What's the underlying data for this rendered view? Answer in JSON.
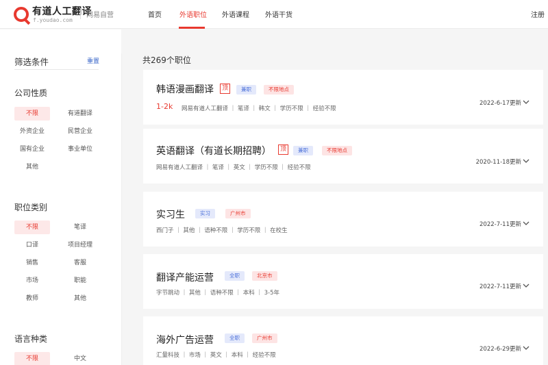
{
  "header": {
    "brand_title": "有道人工翻译",
    "brand_sub": "f.youdao.com",
    "brand_tag": "网易自营",
    "nav": [
      "首页",
      "外语职位",
      "外语课程",
      "外语干货"
    ],
    "register": "注册"
  },
  "sidebar": {
    "title": "筛选条件",
    "reset": "重置",
    "groups": [
      {
        "title": "公司性质",
        "options": [
          "不限",
          "有道翻译",
          "外资企业",
          "民营企业",
          "国有企业",
          "事业单位",
          "其他"
        ]
      },
      {
        "title": "职位类别",
        "options": [
          "不限",
          "笔译",
          "口译",
          "项目经理",
          "销售",
          "客服",
          "市场",
          "职能",
          "教师",
          "其他"
        ]
      },
      {
        "title": "语言种类",
        "options": [
          "不限",
          "中文"
        ]
      }
    ]
  },
  "main": {
    "total": "共269个职位",
    "jobs": [
      {
        "title": "韩语漫画翻译",
        "ding": "顶",
        "tag1": "兼职",
        "tag2": "不限地点",
        "salary": "1-2k",
        "meta": "网易有道人工翻译 ｜ 笔译 ｜ 韩文 ｜ 学历不限 ｜ 经验不限",
        "date": "2022-6-17更新"
      },
      {
        "title": "英语翻译（有道长期招聘）",
        "ding": "顶",
        "tag1": "兼职",
        "tag2": "不限地点",
        "meta": "网易有道人工翻译 ｜ 笔译 ｜ 英文 ｜ 学历不限 ｜ 经验不限",
        "date": "2020-11-18更新"
      },
      {
        "title": "实习生",
        "tag1": "实习",
        "tag2": "广州市",
        "meta": "西门子 ｜ 其他 ｜ 语种不限 ｜ 学历不限 ｜ 在校生",
        "date": "2022-7-11更新"
      },
      {
        "title": "翻译产能运营",
        "tag1": "全职",
        "tag2": "北京市",
        "meta": "字节跳动 ｜ 其他 ｜ 语种不限 ｜ 本科 ｜ 3-5年",
        "date": "2022-7-11更新"
      },
      {
        "title": "海外广告运营",
        "tag1": "全职",
        "tag2": "广州市",
        "meta": "汇量科技 ｜ 市场 ｜ 英文 ｜ 本科 ｜ 经验不限",
        "date": "2022-6-29更新"
      }
    ]
  },
  "colors": {
    "accent": "#e8392f",
    "tag_blue": "#4a6fd9",
    "link": "#3b67c9"
  },
  "icons": {
    "logo": "youdao-logo-icon",
    "expand": "chevron-down-icon"
  }
}
